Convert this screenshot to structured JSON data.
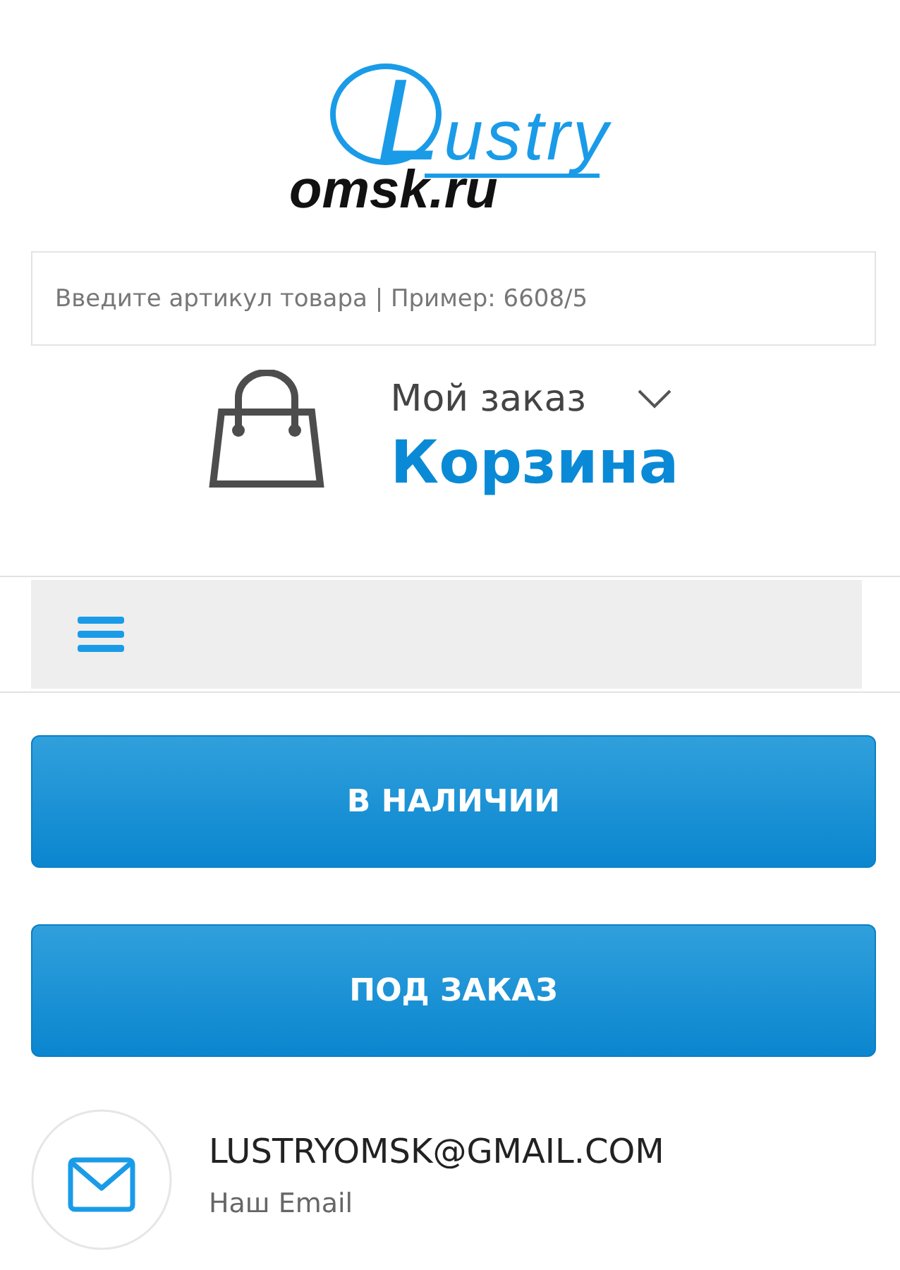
{
  "logo": {
    "wordmark": "Lustry",
    "domain": "omsk.ru"
  },
  "search": {
    "placeholder": "Введите артикул товара | Пример: 6608/5"
  },
  "cart": {
    "subtitle": "Мой заказ",
    "title": "Корзина"
  },
  "buttons": [
    {
      "label": "В НАЛИЧИИ"
    },
    {
      "label": "ПОД ЗАКАЗ"
    }
  ],
  "contacts": [
    {
      "kind": "email",
      "value": "LUSTRYOMSK@GMAIL.COM",
      "caption": "Наш Email"
    }
  ]
}
